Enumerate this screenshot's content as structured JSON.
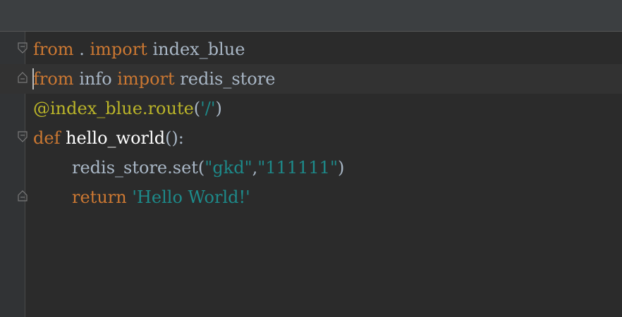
{
  "editor": {
    "colors": {
      "background": "#2b2b2b",
      "keyword": "#cc7832",
      "decorator": "#bbb529",
      "string": "#1d8a8a",
      "default": "#a9b7c6"
    },
    "lines": [
      {
        "t1": "from",
        "t2": " . ",
        "t3": "import",
        "t4": " index_blue"
      },
      {
        "t1": "from",
        "t2": " info ",
        "t3": "import",
        "t4": " redis_store"
      },
      {
        "t1": "@index_blue.route",
        "t2": "(",
        "t3": "'/'",
        "t4": ")"
      },
      {
        "t1": "def",
        "t2": " ",
        "t3": "hello_world",
        "t4": "():"
      },
      {
        "t1": "redis_store.set(",
        "t2": "\"gkd\"",
        "t3": ",",
        "t4": "\"111111\"",
        "t5": ")"
      },
      {
        "t1": "return",
        "t2": " ",
        "t3": "'Hello World!'"
      }
    ]
  }
}
